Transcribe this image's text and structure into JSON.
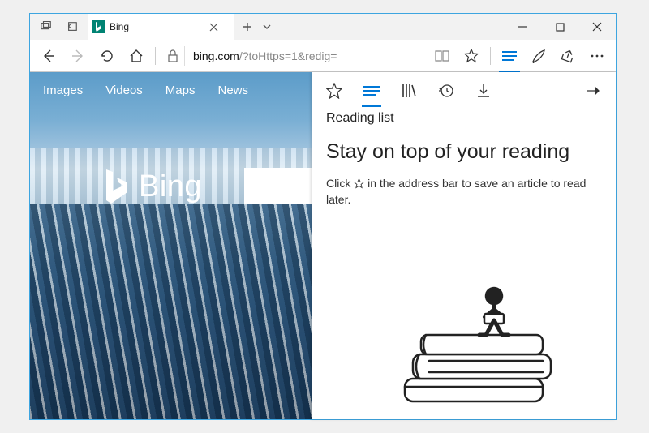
{
  "window": {
    "tab_title": "Bing",
    "address_host": "bing.com",
    "address_rest": "/?toHttps=1&redig="
  },
  "bing": {
    "nav": {
      "images": "Images",
      "videos": "Videos",
      "maps": "Maps",
      "news": "News"
    },
    "brand": "Bing"
  },
  "hub": {
    "section": "Reading list",
    "title": "Stay on top of your reading",
    "desc_before": "Click ",
    "desc_after": " in the address bar to save an article to read later."
  }
}
